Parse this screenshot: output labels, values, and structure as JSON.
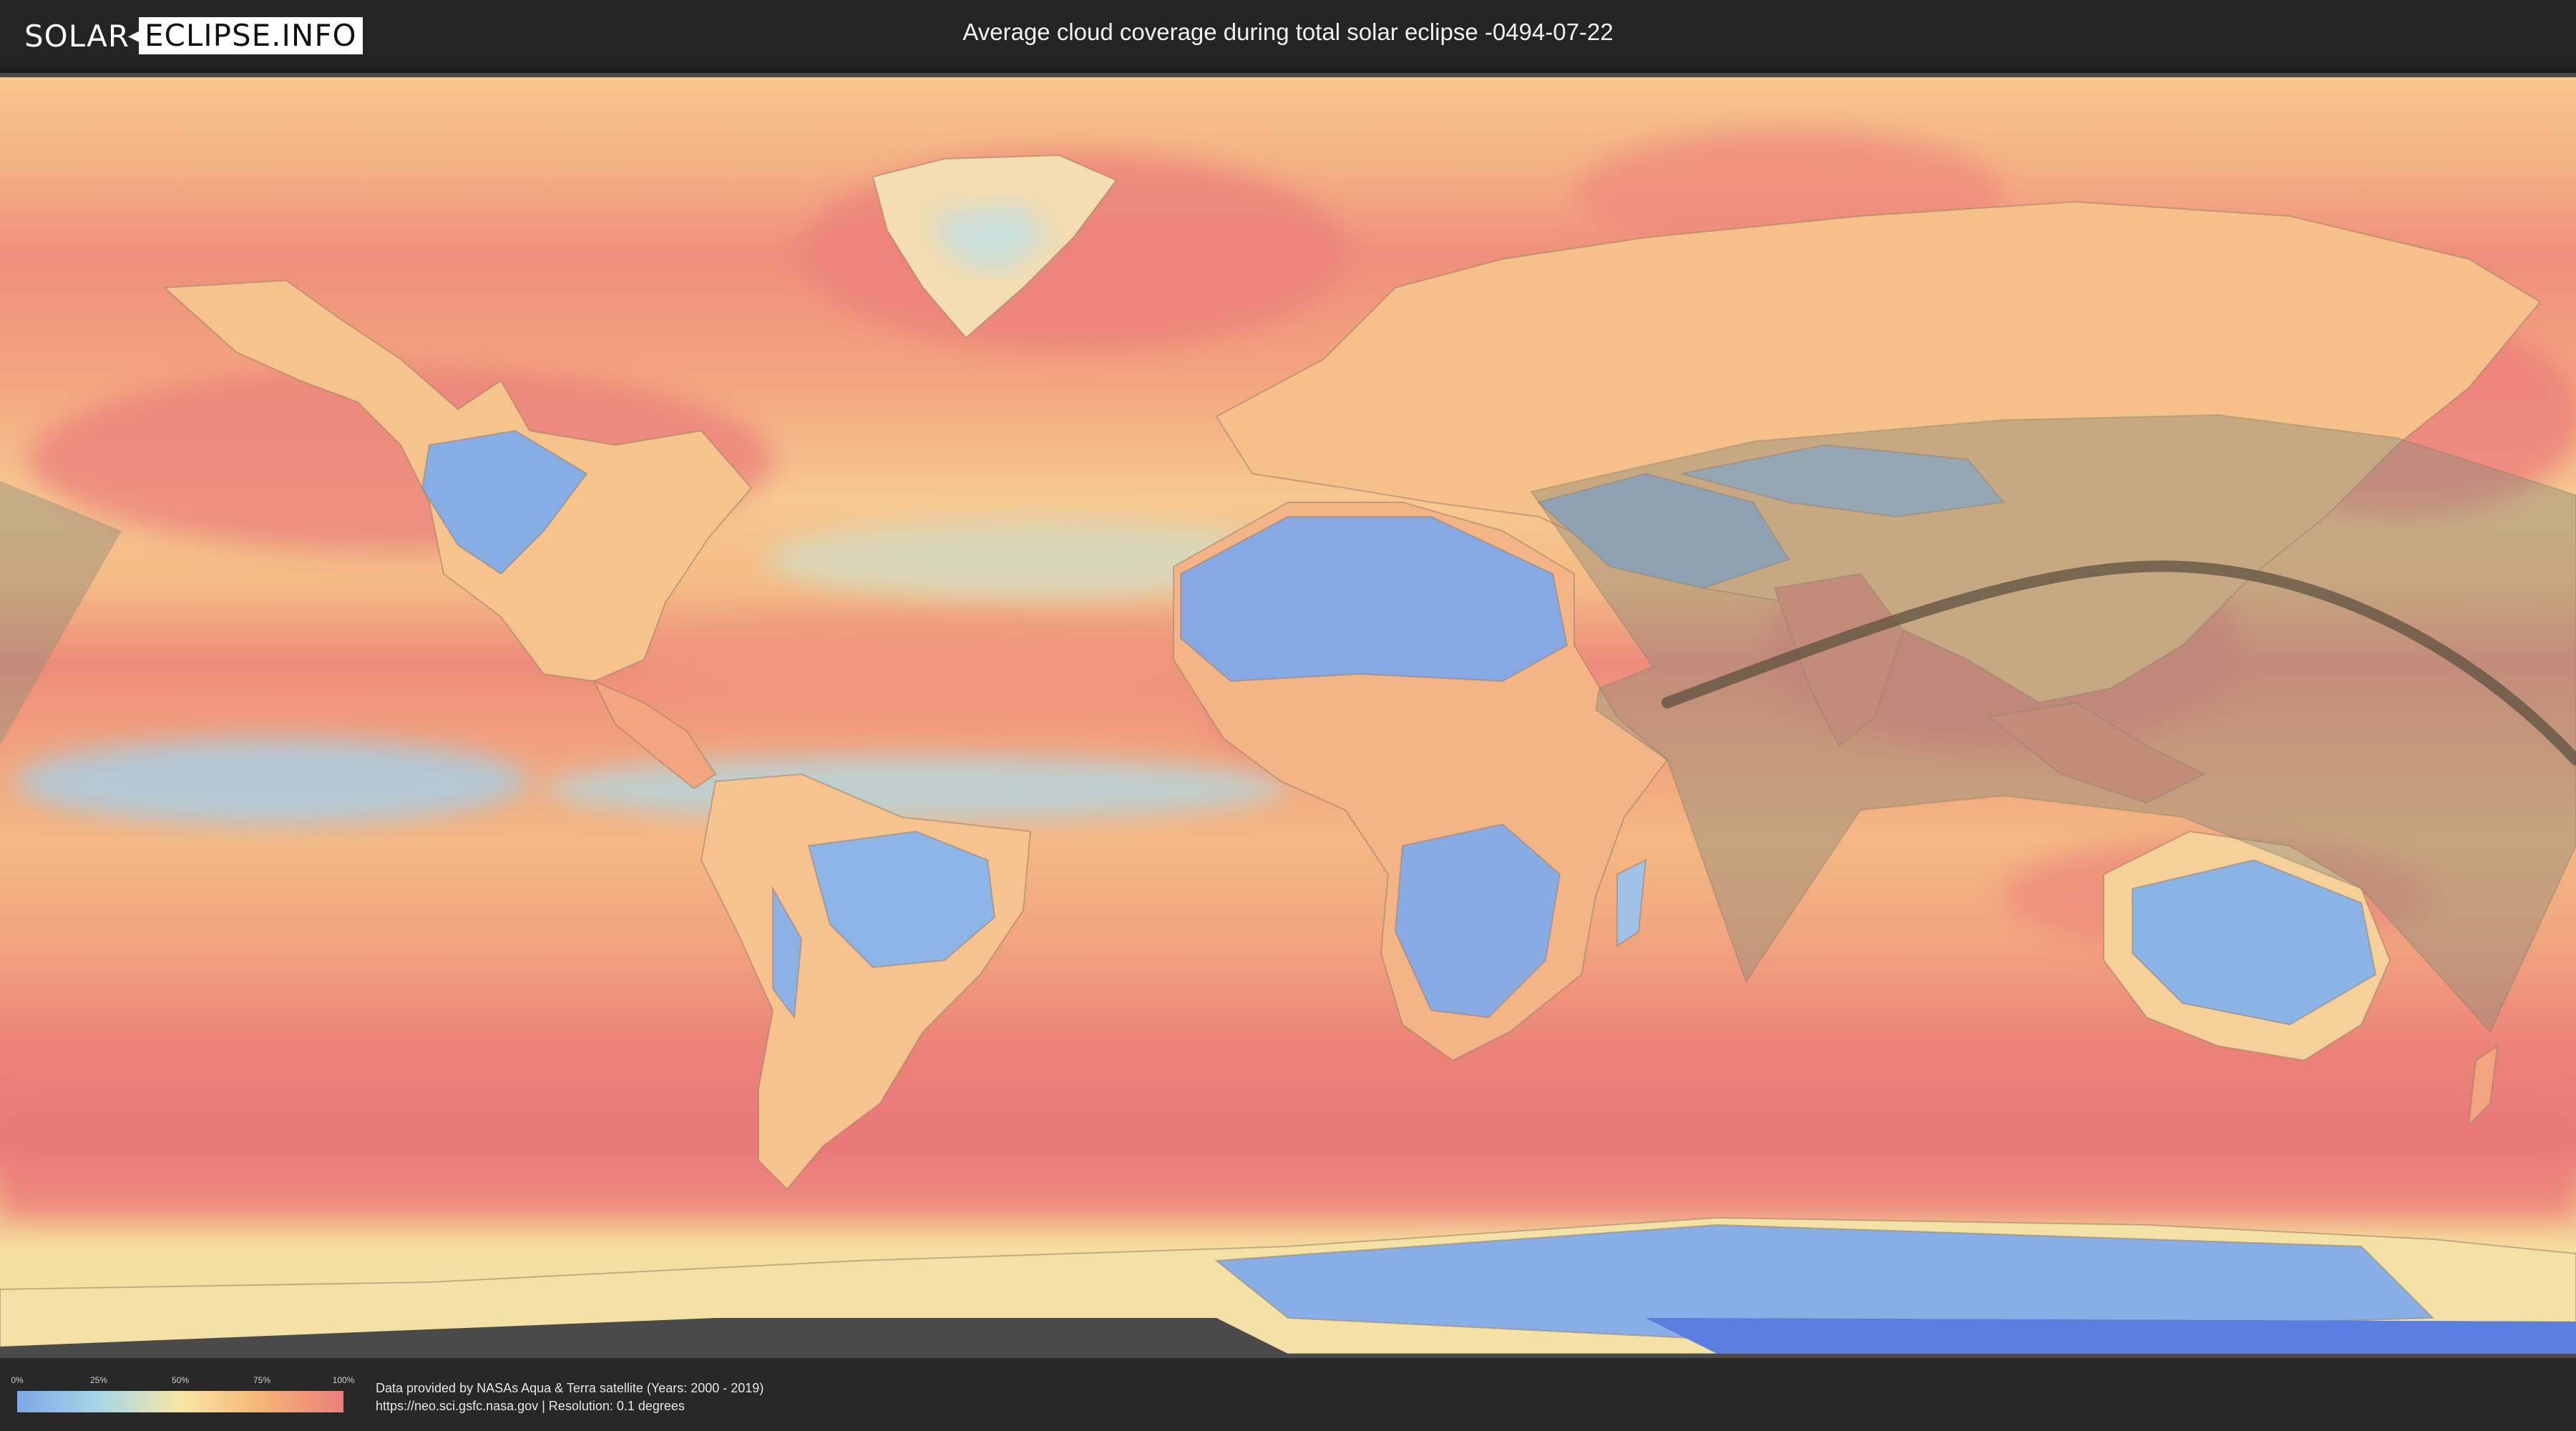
{
  "header": {
    "logo_part1": "SOLAR",
    "logo_part2": "ECLIPSE.INFO",
    "title": "Average cloud coverage during total solar eclipse -0494-07-22"
  },
  "map": {
    "type": "cloud-coverage-world-map",
    "icon": "world-map",
    "colors": {
      "background_ocean": "#f2a07c",
      "high_cloud": "#e9787a",
      "mid_cloud": "#f6c58a",
      "low_cloud": "#f5e3a3",
      "clear_sky": "#7aa3e3",
      "eclipse_zone": "#a09a80",
      "central_path": "#5a5040"
    }
  },
  "legend": {
    "ticks": [
      "0%",
      "25%",
      "50%",
      "75%",
      "100%"
    ],
    "gradient_colors": [
      "#7ea7e8",
      "#a6d6e6",
      "#f7e7a6",
      "#f6b476",
      "#ec7e7c"
    ]
  },
  "footer": {
    "credit_line1": "Data provided by NASAs Aqua & Terra satellite (Years: 2000 - 2019)",
    "credit_line2": "https://neo.sci.gsfc.nasa.gov | Resolution: 0.1 degrees"
  }
}
